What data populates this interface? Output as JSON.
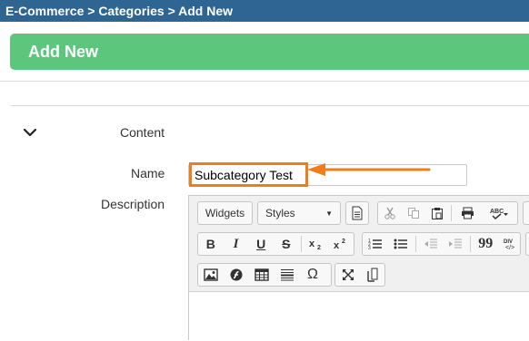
{
  "breadcrumb": {
    "text": "E-Commerce > Categories > Add New"
  },
  "header": {
    "title": "Add New"
  },
  "section": {
    "label": "Content",
    "toggle_icon": "chevron-down-icon"
  },
  "form": {
    "name_label": "Name",
    "name_value": "Subcategory Test",
    "description_label": "Description"
  },
  "toolbar": {
    "widgets_label": "Widgets",
    "styles_label": "Styles",
    "bold_label": "B",
    "italic_label": "I",
    "underline_label": "U",
    "strike_label": "S",
    "quote_label": "99",
    "omega_label": "Ω"
  },
  "colors": {
    "breadcrumb_bg": "#2f6592",
    "header_bg": "#5cc67d",
    "highlight": "#f07c1a"
  }
}
